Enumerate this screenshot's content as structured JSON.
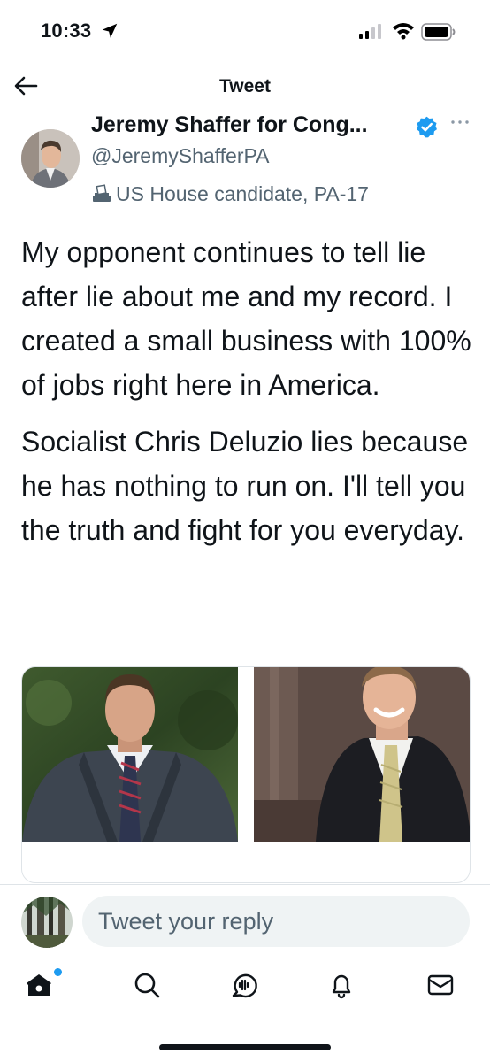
{
  "status_bar": {
    "time": "10:33"
  },
  "header": {
    "title": "Tweet"
  },
  "author": {
    "display_name": "Jeremy Shaffer for Cong...",
    "handle": "@JeremyShafferPA",
    "label": "US House candidate, PA-17",
    "verified": true
  },
  "tweet": {
    "paragraphs": [
      "My opponent continues to tell lie after lie about me and my record. I created a small business with 100% of jobs right here in America.",
      "Socialist Chris Deluzio lies because he has nothing to run on. I'll tell you the truth and fight for you everyday."
    ]
  },
  "reply": {
    "placeholder": "Tweet your reply"
  },
  "tab_bar": {
    "items": [
      "home-icon",
      "search-icon",
      "spaces-icon",
      "notifications-icon",
      "messages-icon"
    ],
    "home_has_notification": true
  },
  "colors": {
    "accent": "#1d9bf0",
    "text": "#0f1419",
    "secondary_text": "#536471",
    "input_bg": "#eff3f4",
    "divider": "#dfe4e8"
  }
}
